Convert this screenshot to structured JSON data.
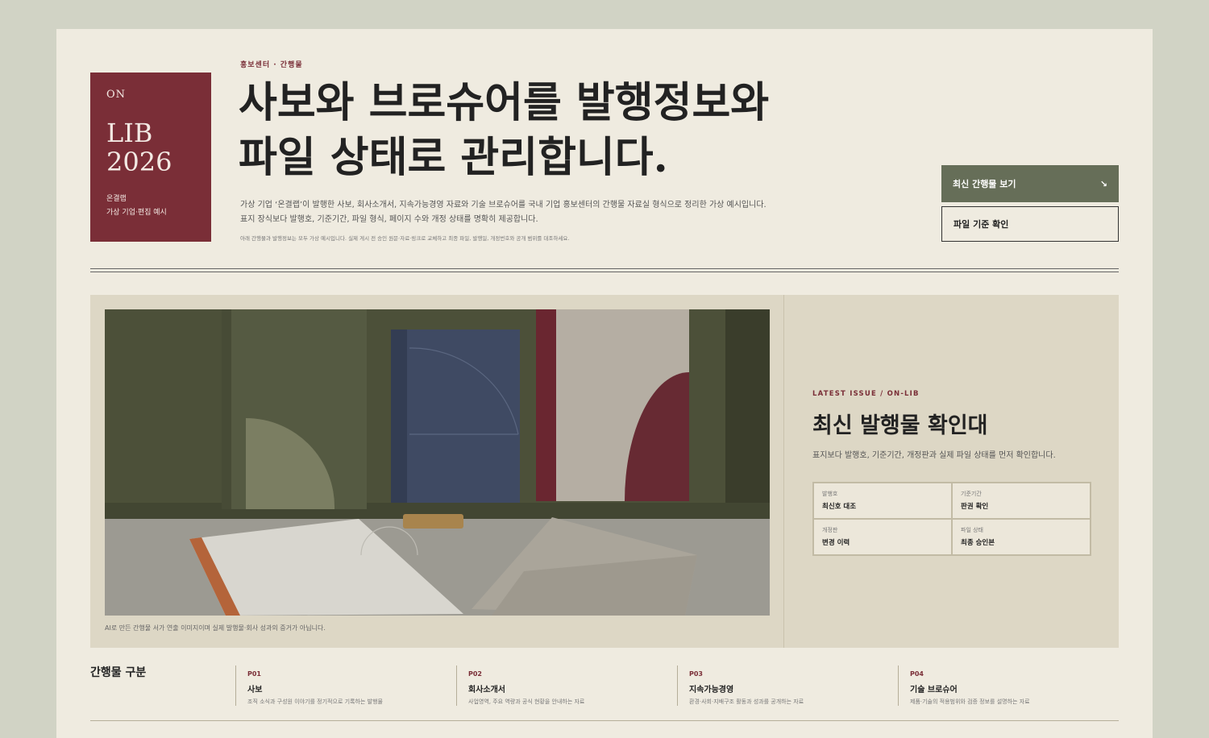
{
  "logo": {
    "on": "ON",
    "line1": "LIB",
    "line2": "2026",
    "sub1": "온결랩",
    "sub2": "가상 기업·편집 예시"
  },
  "hero": {
    "eyebrow": "홍보센터 · 간행물",
    "title_line1": "사보와 브로슈어를 발행정보와",
    "title_line2": "파일 상태로 관리합니다.",
    "desc_line1": "가상 기업 ‘온결랩’이 발행한 사보, 회사소개서, 지속가능경영 자료와 기술 브로슈어를 국내 기업 홍보센터의 간행물 자료실 형식으로 정리한 가상 예시입니다.",
    "desc_line2": "표지 장식보다 발행호, 기준기간, 파일 형식, 페이지 수와 개정 상태를 명확히 제공합니다.",
    "note": "아래 간행물과 발행정보는 모두 가상 예시입니다. 실제 게시 전 승인 원문·자료·링크로 교체하고 최종 파일, 발행일, 개정번호와 공개 범위를 대조하세요."
  },
  "buttons": {
    "primary": "최신 간행물 보기",
    "primary_icon": "↘",
    "secondary": "파일 기준 확인"
  },
  "feature": {
    "caption": "AI로 만든 간행물 서가 연출 이미지이며 실제 발행물·회사 성과의 증거가 아닙니다.",
    "eyebrow": "LATEST ISSUE / ON-LIB",
    "title": "최신 발행물 확인대",
    "desc": "표지보다 발행호, 기준기간, 개정판과 실제 파일 상태를 먼저 확인합니다.",
    "info": [
      {
        "label": "발행호",
        "value": "최신호 대조"
      },
      {
        "label": "기준기간",
        "value": "판권 확인"
      },
      {
        "label": "개정판",
        "value": "변경 이력"
      },
      {
        "label": "파일 상태",
        "value": "최종 승인본"
      }
    ]
  },
  "categories": {
    "title": "간행물 구분",
    "items": [
      {
        "code": "P01",
        "name": "사보",
        "desc": "조직 소식과 구성원 이야기를 정기적으로 기록하는 발행물"
      },
      {
        "code": "P02",
        "name": "회사소개서",
        "desc": "사업영역, 주요 역량과 공식 현황을 안내하는 자료"
      },
      {
        "code": "P03",
        "name": "지속가능경영",
        "desc": "환경·사회·지배구조 활동과 성과를 공개하는 자료"
      },
      {
        "code": "P04",
        "name": "기술 브로슈어",
        "desc": "제품·기술의 적용범위와 검증 정보를 설명하는 자료"
      }
    ]
  },
  "colors": {
    "accent": "#7a2e37",
    "primary_button": "#666e58",
    "page_bg": "#efebe0",
    "feature_bg": "#ddd7c5"
  }
}
